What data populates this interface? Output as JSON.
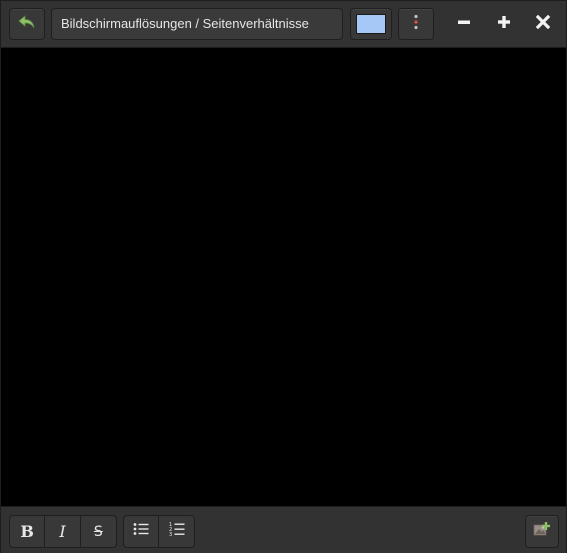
{
  "window": {
    "title": "Bildschirmauflösungen / Seitenverhältnisse",
    "note_color": "#a6c8f7",
    "canvas_color": "#000000"
  },
  "titlebar": {
    "back_icon": "undo-arrow-icon",
    "back_icon_color": "#8ec06a",
    "menu_icon": "vertical-dots-icon",
    "minimize_icon": "minus-icon",
    "maximize_icon": "plus-icon",
    "close_icon": "close-icon"
  },
  "toolbar": {
    "bold_label": "B",
    "italic_label": "I",
    "strike_label": "S",
    "bullet_list_icon": "bullet-list-icon",
    "numbered_list_icon": "numbered-list-icon",
    "insert_image_icon": "insert-image-icon"
  }
}
